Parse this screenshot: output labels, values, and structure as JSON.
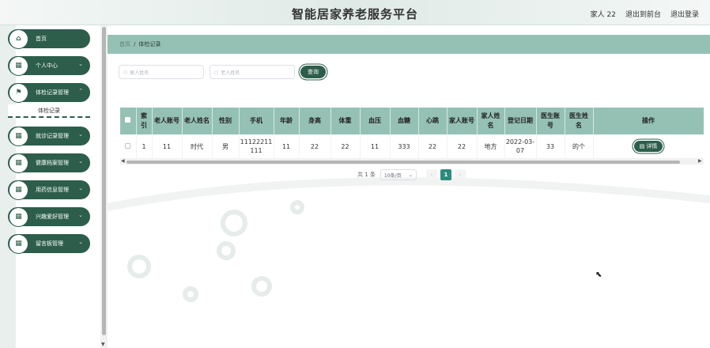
{
  "header": {
    "title": "智能居家养老服务平台",
    "user": "家人 22",
    "back_to_front": "退出到前台",
    "logout": "退出登录"
  },
  "sidebar": {
    "items": [
      {
        "label": "首页",
        "icon": "home-icon",
        "arrow": false
      },
      {
        "label": "个人中心",
        "icon": "grid-icon",
        "arrow": true
      },
      {
        "label": "体检记录管理",
        "icon": "flag-icon",
        "arrow": true
      },
      {
        "label": "就诊记录管理",
        "icon": "grid-icon",
        "arrow": true
      },
      {
        "label": "健康档案管理",
        "icon": "grid-icon",
        "arrow": true
      },
      {
        "label": "用药信息管理",
        "icon": "grid-icon",
        "arrow": true
      },
      {
        "label": "兴趣爱好管理",
        "icon": "grid-icon",
        "arrow": true
      },
      {
        "label": "留言板管理",
        "icon": "grid-icon",
        "arrow": true
      }
    ],
    "submenu_label": "体检记录"
  },
  "breadcrumb": {
    "home": "首页",
    "separator": "/",
    "current": "体检记录"
  },
  "search": {
    "family_name_placeholder": "家人姓名",
    "elder_name_placeholder": "老人姓名",
    "query_button": "查询"
  },
  "table": {
    "columns": [
      "索引",
      "老人账号",
      "老人姓名",
      "性别",
      "手机",
      "年龄",
      "身高",
      "体重",
      "血压",
      "血糖",
      "心跳",
      "家人账号",
      "家人姓名",
      "登记日期",
      "医生账号",
      "医生姓名",
      "操作"
    ],
    "rows": [
      {
        "index": "1",
        "elder_account": "11",
        "elder_name": "时代",
        "gender": "男",
        "phone": "11122211111",
        "age": "11",
        "height": "22",
        "weight": "22",
        "blood_pressure": "11",
        "blood_sugar": "333",
        "heartbeat": "22",
        "family_account": "22",
        "family_name": "地方",
        "register_date": "2022-03-07",
        "doctor_account": "33",
        "doctor_name": "的个",
        "action": "详情"
      }
    ]
  },
  "pagination": {
    "total": "共 1 条",
    "page_size": "10条/页",
    "current_page": "1"
  },
  "colors": {
    "accent": "#2c5e4b",
    "header_green": "#95c1b5",
    "page_active": "#2c8c7c"
  }
}
